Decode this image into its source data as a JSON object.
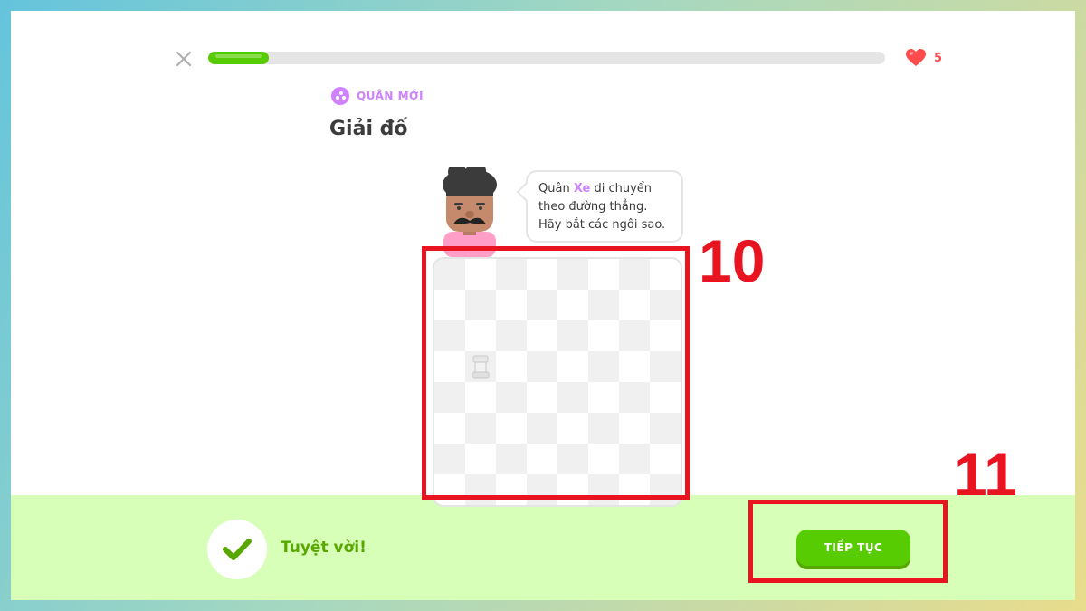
{
  "progress": {
    "value": 0.09
  },
  "hearts": {
    "count": "5",
    "icon": "heart-icon",
    "color": "#ff4b4b"
  },
  "close": {
    "icon": "close-icon"
  },
  "header": {
    "tag_label": "QUÂN MỚI",
    "tag_icon": "chess-piece-icon",
    "title": "Giải đố"
  },
  "speech": {
    "part1": "Quân ",
    "highlight": "Xe",
    "part2": " di chuyển",
    "line2": "theo đường thẳng.",
    "line3": "Hãy bắt các ngôi sao."
  },
  "board": {
    "rows": 8,
    "cols": 8,
    "piece": "rook-icon",
    "piece_square": {
      "row": 3,
      "col": 1
    }
  },
  "annotations": [
    {
      "label": "10",
      "target": "board"
    },
    {
      "label": "11",
      "target": "continue-button"
    }
  ],
  "footer": {
    "message": "Tuyệt vời!",
    "check_icon": "check-icon",
    "button_label": "TIẾP TỤC"
  },
  "colors": {
    "accent_green": "#58cc02",
    "footer_bg": "#d7ffb8",
    "purple": "#ce82ff",
    "annotation_red": "#e8141f"
  }
}
